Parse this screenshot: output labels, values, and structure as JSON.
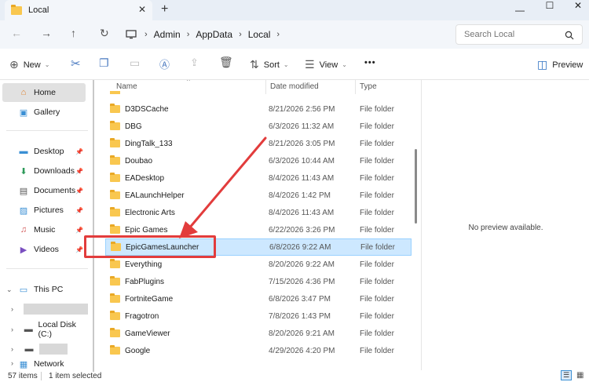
{
  "window": {
    "tab_title": "Local",
    "tab_close": "✕",
    "new_tab": "+",
    "minimize": "—",
    "maximize": "☐",
    "close": "✕"
  },
  "address": {
    "back": "←",
    "forward": "→",
    "up": "↑",
    "refresh": "↻",
    "crumbs": [
      "Admin",
      "AppData",
      "Local"
    ],
    "search_placeholder": "Search Local"
  },
  "toolbar": {
    "new_label": "New",
    "sort_label": "Sort",
    "view_label": "View",
    "more_label": "•••",
    "preview_label": "Preview"
  },
  "sidebar": {
    "home": "Home",
    "gallery": "Gallery",
    "desktop": "Desktop",
    "downloads": "Downloads",
    "documents": "Documents",
    "pictures": "Pictures",
    "music": "Music",
    "videos": "Videos",
    "this_pc": "This PC",
    "local_disk": "Local Disk (C:)",
    "network": "Network"
  },
  "columns": {
    "name": "Name",
    "date": "Date modified",
    "type": "Type"
  },
  "rows": [
    {
      "name": "D3DSCache",
      "date": "8/21/2026 2:56 PM",
      "type": "File folder"
    },
    {
      "name": "DBG",
      "date": "6/3/2026 11:32 AM",
      "type": "File folder"
    },
    {
      "name": "DingTalk_133",
      "date": "8/21/2026 3:05 PM",
      "type": "File folder"
    },
    {
      "name": "Doubao",
      "date": "6/3/2026 10:44 AM",
      "type": "File folder"
    },
    {
      "name": "EADesktop",
      "date": "8/4/2026 11:43 AM",
      "type": "File folder"
    },
    {
      "name": "EALaunchHelper",
      "date": "8/4/2026 1:42 PM",
      "type": "File folder"
    },
    {
      "name": "Electronic Arts",
      "date": "8/4/2026 11:43 AM",
      "type": "File folder"
    },
    {
      "name": "Epic Games",
      "date": "6/22/2026 3:26 PM",
      "type": "File folder"
    },
    {
      "name": "EpicGamesLauncher",
      "date": "6/8/2026 9:22 AM",
      "type": "File folder"
    },
    {
      "name": "Everything",
      "date": "8/20/2026 9:22 AM",
      "type": "File folder"
    },
    {
      "name": "FabPlugins",
      "date": "7/15/2026 4:36 PM",
      "type": "File folder"
    },
    {
      "name": "FortniteGame",
      "date": "6/8/2026 3:47 PM",
      "type": "File folder"
    },
    {
      "name": "Fragotron",
      "date": "7/8/2026 1:43 PM",
      "type": "File folder"
    },
    {
      "name": "GameViewer",
      "date": "8/20/2026 9:21 AM",
      "type": "File folder"
    },
    {
      "name": "Google",
      "date": "4/29/2026 4:20 PM",
      "type": "File folder"
    }
  ],
  "preview": {
    "text": "No preview available."
  },
  "status": {
    "items": "57 items",
    "selected": "1 item selected"
  },
  "colors": {
    "selection": "#cde8ff",
    "annotation": "#e23c3c",
    "folder": "#f9c74f"
  }
}
